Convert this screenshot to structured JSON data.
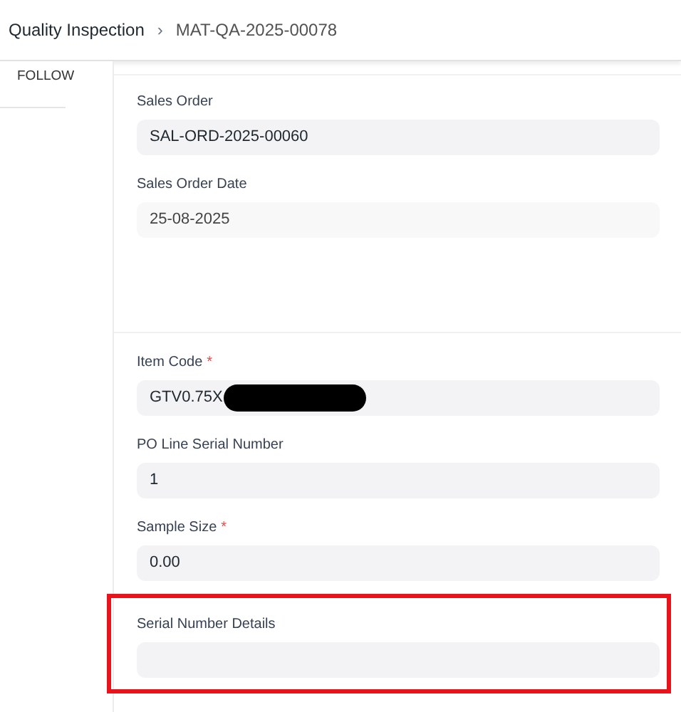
{
  "breadcrumb": {
    "parent": "Quality Inspection",
    "separator": "›",
    "current": "MAT-QA-2025-00078"
  },
  "sidebar": {
    "follow": "FOLLOW"
  },
  "sections": [
    {
      "fields": [
        {
          "label": "Sales Order",
          "required": false,
          "value": "SAL-ORD-2025-00060",
          "read_only": false,
          "redacted": false,
          "highlighted": false
        },
        {
          "label": "Sales Order Date",
          "required": false,
          "value": "25-08-2025",
          "read_only": true,
          "redacted": false,
          "highlighted": false
        }
      ]
    },
    {
      "fields": [
        {
          "label": "Item Code",
          "required": true,
          "value": "GTV0.75X",
          "read_only": false,
          "redacted": true,
          "highlighted": false
        },
        {
          "label": "PO Line Serial Number",
          "required": false,
          "value": "1",
          "read_only": false,
          "redacted": false,
          "highlighted": false
        },
        {
          "label": "Sample Size",
          "required": true,
          "value": "0.00",
          "read_only": false,
          "redacted": false,
          "highlighted": false
        },
        {
          "label": "Serial Number Details",
          "required": false,
          "read_only": false,
          "redacted": false,
          "highlighted": true
        }
      ]
    }
  ],
  "required_mark": "*"
}
